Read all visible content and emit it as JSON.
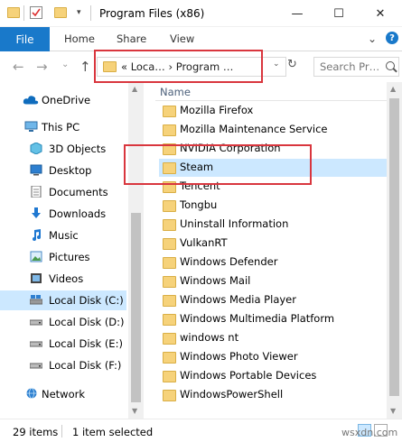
{
  "window": {
    "title": "Program Files (x86)",
    "minimize": "—",
    "maximize": "☐",
    "close": "✕"
  },
  "ribbon": {
    "file": "File",
    "tabs": [
      "Home",
      "Share",
      "View"
    ],
    "toggle": "⌄",
    "help": "?"
  },
  "address": {
    "back": "←",
    "forward": "→",
    "recent": "⌄",
    "up": "↑",
    "path": "« Loca… › Program …",
    "chevron": "⌄",
    "refresh": "↻",
    "search_placeholder": "Search Pr…"
  },
  "sidebar": {
    "items": [
      {
        "label": "OneDrive",
        "icon": "cloud-icon"
      },
      {
        "label": "This PC",
        "icon": "computer-icon"
      },
      {
        "label": "3D Objects",
        "icon": "cube-icon"
      },
      {
        "label": "Desktop",
        "icon": "desktop-icon"
      },
      {
        "label": "Documents",
        "icon": "documents-icon"
      },
      {
        "label": "Downloads",
        "icon": "download-icon"
      },
      {
        "label": "Music",
        "icon": "music-icon"
      },
      {
        "label": "Pictures",
        "icon": "pictures-icon"
      },
      {
        "label": "Videos",
        "icon": "videos-icon"
      },
      {
        "label": "Local Disk (C:)",
        "icon": "drive-icon"
      },
      {
        "label": "Local Disk (D:)",
        "icon": "drive-icon"
      },
      {
        "label": "Local Disk (E:)",
        "icon": "drive-icon"
      },
      {
        "label": "Local Disk (F:)",
        "icon": "drive-icon"
      },
      {
        "label": "Network",
        "icon": "network-icon"
      }
    ]
  },
  "filelist": {
    "header": "Name",
    "items": [
      "Mozilla Firefox",
      "Mozilla Maintenance Service",
      "NVIDIA Corporation",
      "Steam",
      "Tencent",
      "Tongbu",
      "Uninstall Information",
      "VulkanRT",
      "Windows Defender",
      "Windows Mail",
      "Windows Media Player",
      "Windows Multimedia Platform",
      "windows nt",
      "Windows Photo Viewer",
      "Windows Portable Devices",
      "WindowsPowerShell"
    ],
    "selected": "Steam"
  },
  "status": {
    "count": "29 items",
    "selected": "1 item selected"
  },
  "watermark": "wsxdn.com",
  "colors": {
    "accent": "#1979ca",
    "selection": "#cce8ff",
    "highlight_box": "#d9363e",
    "folder": "#f6d27a"
  }
}
